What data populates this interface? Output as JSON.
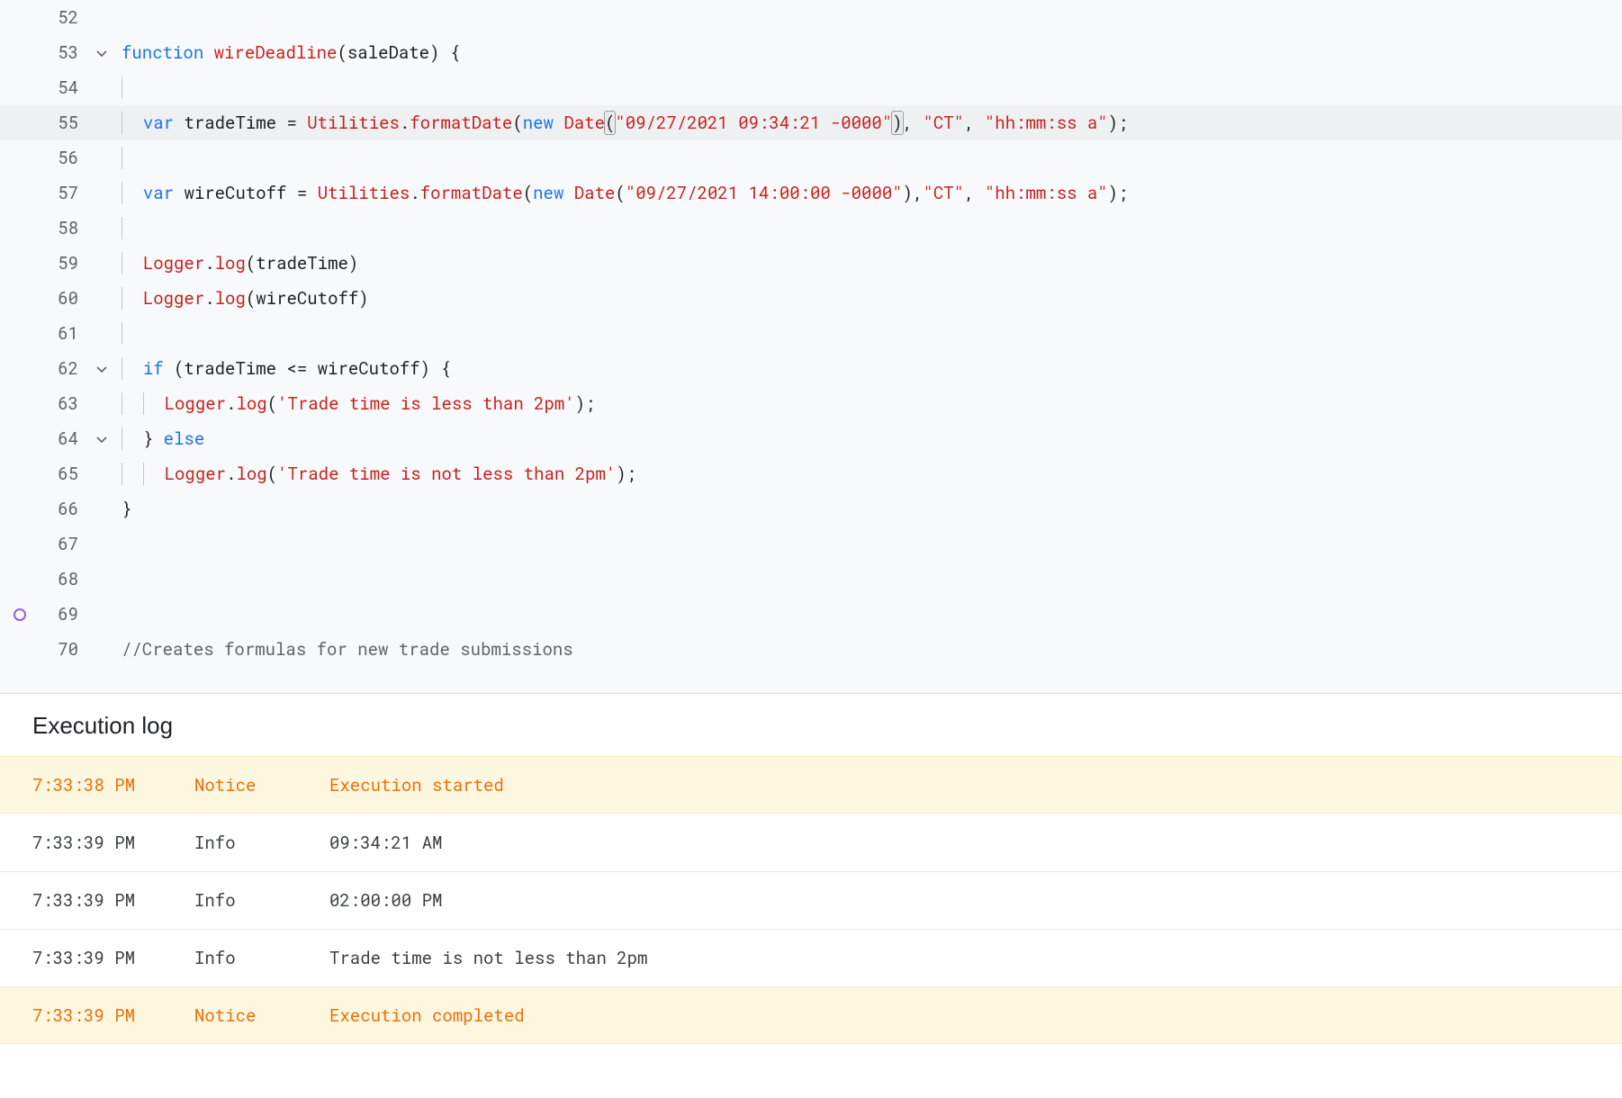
{
  "editor": {
    "lines": [
      {
        "num": "52",
        "fold": "",
        "content": ""
      },
      {
        "num": "53",
        "fold": "down",
        "content": ""
      },
      {
        "num": "54",
        "fold": "",
        "content": ""
      },
      {
        "num": "55",
        "fold": "",
        "content": ""
      },
      {
        "num": "56",
        "fold": "",
        "content": ""
      },
      {
        "num": "57",
        "fold": "",
        "content": ""
      },
      {
        "num": "58",
        "fold": "",
        "content": ""
      },
      {
        "num": "59",
        "fold": "",
        "content": ""
      },
      {
        "num": "60",
        "fold": "",
        "content": ""
      },
      {
        "num": "61",
        "fold": "",
        "content": ""
      },
      {
        "num": "62",
        "fold": "down",
        "content": ""
      },
      {
        "num": "63",
        "fold": "",
        "content": ""
      },
      {
        "num": "64",
        "fold": "down",
        "content": ""
      },
      {
        "num": "65",
        "fold": "",
        "content": ""
      },
      {
        "num": "66",
        "fold": "",
        "content": ""
      },
      {
        "num": "67",
        "fold": "",
        "content": ""
      },
      {
        "num": "68",
        "fold": "",
        "content": ""
      },
      {
        "num": "69",
        "fold": "",
        "content": ""
      },
      {
        "num": "70",
        "fold": "",
        "content": ""
      }
    ],
    "tokens": {
      "function": "function",
      "wireDeadline": "wireDeadline",
      "saleDate": "saleDate",
      "var": "var",
      "tradeTime": "tradeTime",
      "eq": " = ",
      "Utilities": "Utilities",
      "formatDate": "formatDate",
      "new": "new",
      "Date": "Date",
      "str_trade": "\"09/27/2021 09:34:21 -0000\"",
      "str_ct": "\"CT\"",
      "str_fmt": "\"hh:mm:ss a\"",
      "wireCutoff": "wireCutoff",
      "str_cutoff": "\"09/27/2021 14:00:00 -0000\"",
      "Logger": "Logger",
      "log": "log",
      "if": "if",
      "cond": "(tradeTime <= wireCutoff) {",
      "str_less": "'Trade time is less than 2pm'",
      "else": "else",
      "str_notless": "'Trade time is not less than 2pm'",
      "comment70": "//Creates formulas for new trade submissions"
    }
  },
  "log": {
    "title": "Execution log",
    "rows": [
      {
        "time": "7:33:38 PM",
        "level": "Notice",
        "msg": "Execution started",
        "type": "notice"
      },
      {
        "time": "7:33:39 PM",
        "level": "Info",
        "msg": "09:34:21 AM",
        "type": "info"
      },
      {
        "time": "7:33:39 PM",
        "level": "Info",
        "msg": "02:00:00 PM",
        "type": "info"
      },
      {
        "time": "7:33:39 PM",
        "level": "Info",
        "msg": "Trade time is not less than 2pm",
        "type": "info"
      },
      {
        "time": "7:33:39 PM",
        "level": "Notice",
        "msg": "Execution completed",
        "type": "notice"
      }
    ]
  }
}
